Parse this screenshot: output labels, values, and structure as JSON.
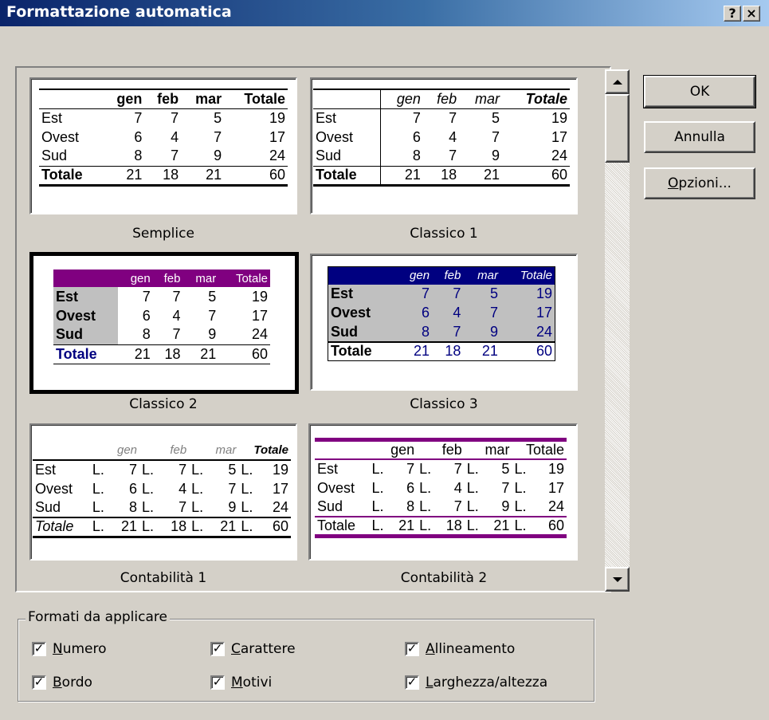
{
  "window": {
    "title": "Formattazione automatica",
    "help_label": "?",
    "close_label": "×"
  },
  "tables": {
    "header": [
      "",
      "gen",
      "feb",
      "mar",
      "Totale"
    ],
    "rows": [
      [
        "Est",
        "7",
        "7",
        "5",
        "19"
      ],
      [
        "Ovest",
        "6",
        "4",
        "7",
        "17"
      ],
      [
        "Sud",
        "8",
        "7",
        "9",
        "24"
      ],
      [
        "Totale",
        "21",
        "18",
        "21",
        "60"
      ]
    ],
    "currency": "L."
  },
  "formats": [
    {
      "caption": "Semplice"
    },
    {
      "caption": "Classico 1"
    },
    {
      "caption": "Classico 2",
      "selected": true
    },
    {
      "caption": "Classico 3"
    },
    {
      "caption": "Contabilità 1"
    },
    {
      "caption": "Contabilità 2"
    }
  ],
  "buttons": {
    "ok": "OK",
    "cancel": "Annulla",
    "options_key": "O",
    "options_rest": "pzioni..."
  },
  "group": {
    "legend": "Formati da applicare",
    "checks": [
      {
        "key": "N",
        "rest": "umero",
        "checked": true
      },
      {
        "key": "C",
        "rest": "arattere",
        "checked": true
      },
      {
        "key": "A",
        "rest": "llineamento",
        "checked": true
      },
      {
        "key": "B",
        "rest": "ordo",
        "checked": true
      },
      {
        "key": "M",
        "rest": "otivi",
        "checked": true
      },
      {
        "key": "L",
        "rest": "arghezza/altezza",
        "checked": true
      }
    ],
    "check_mark": "✓"
  },
  "colors": {
    "title_start": "#0a246a",
    "title_end": "#a6caf0",
    "purple": "#800080",
    "navy": "#000080",
    "face": "#d4d0c8"
  }
}
